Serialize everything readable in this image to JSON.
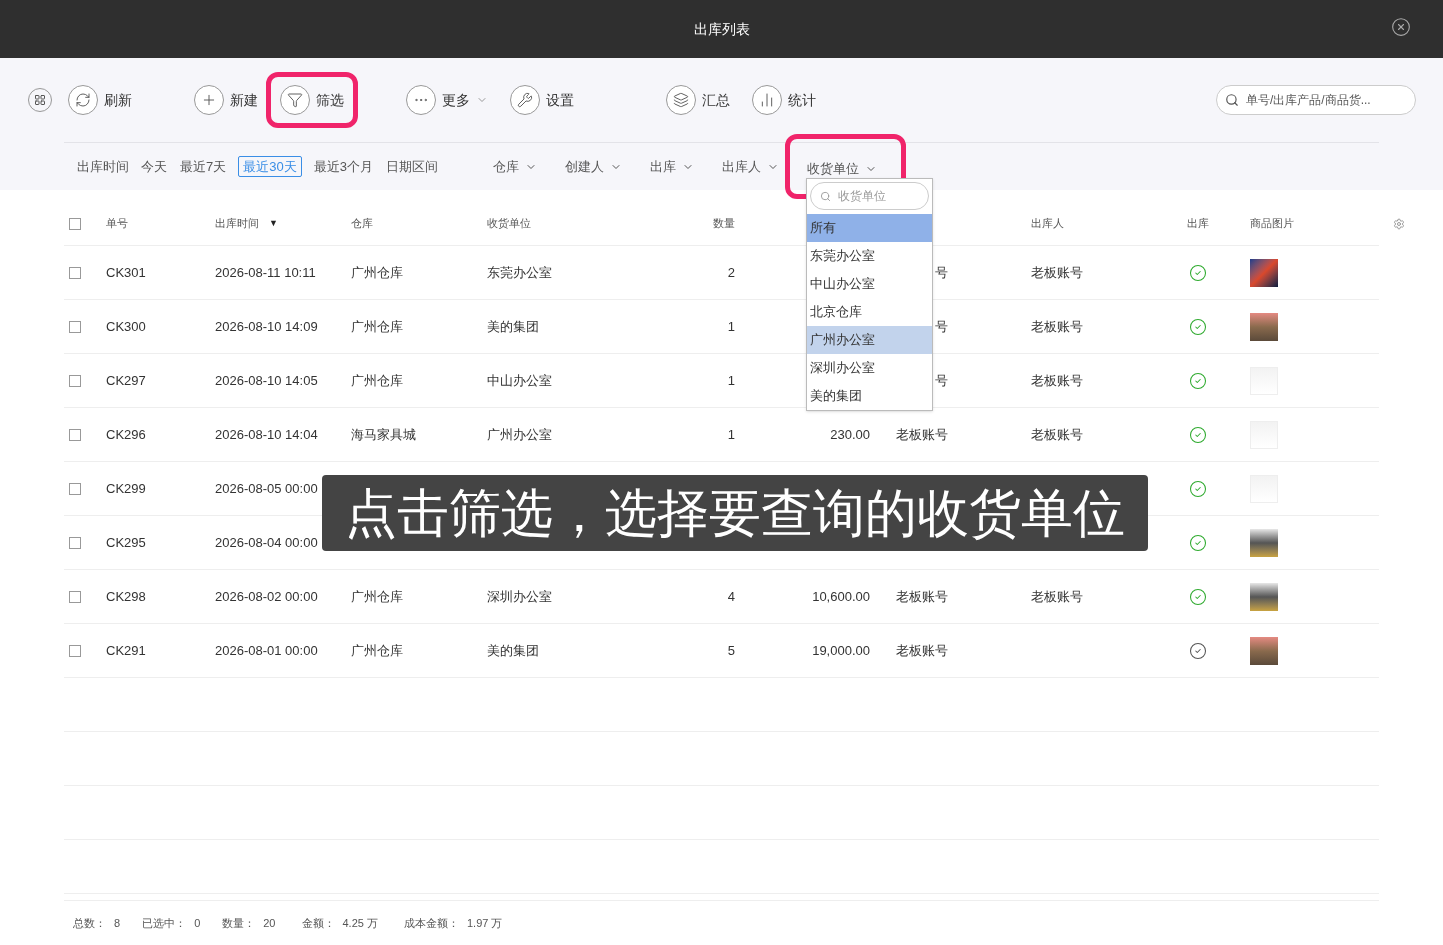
{
  "window": {
    "title": "出库列表"
  },
  "toolbar": {
    "groups": [
      [
        {
          "kind": "refresh",
          "label": "刷新",
          "highlighted": false,
          "has_menu": false
        }
      ],
      [
        {
          "kind": "plus",
          "label": "新建",
          "highlighted": false,
          "has_menu": false
        },
        {
          "kind": "funnel",
          "label": "筛选",
          "highlighted": true,
          "has_menu": false
        }
      ],
      [
        {
          "kind": "dots",
          "label": "更多",
          "highlighted": false,
          "has_menu": true
        },
        {
          "kind": "wrench",
          "label": "设置",
          "highlighted": false,
          "has_menu": false
        }
      ],
      [
        {
          "kind": "layers",
          "label": "汇总",
          "highlighted": false,
          "has_menu": false
        },
        {
          "kind": "bars",
          "label": "统计",
          "highlighted": false,
          "has_menu": false
        }
      ]
    ],
    "search": {
      "placeholder": "单号/出库产品/商品货..."
    }
  },
  "filters": {
    "date_label": "出库时间",
    "date_options": [
      {
        "label": "今天",
        "selected": false
      },
      {
        "label": "最近7天",
        "selected": false
      },
      {
        "label": "最近30天",
        "selected": true
      },
      {
        "label": "最近3个月",
        "selected": false
      },
      {
        "label": "日期区间",
        "selected": false
      }
    ],
    "dropdowns": [
      {
        "label": "仓库",
        "highlighted": false
      },
      {
        "label": "创建人",
        "highlighted": false
      },
      {
        "label": "出库",
        "highlighted": false
      },
      {
        "label": "出库人",
        "highlighted": false
      },
      {
        "label": "收货单位",
        "highlighted": true
      }
    ]
  },
  "dropdown_menu": {
    "search_placeholder": "收货单位",
    "options": [
      {
        "label": "所有",
        "selected": true,
        "hovered": false
      },
      {
        "label": "东莞办公室",
        "selected": false,
        "hovered": false
      },
      {
        "label": "中山办公室",
        "selected": false,
        "hovered": false
      },
      {
        "label": "北京仓库",
        "selected": false,
        "hovered": false
      },
      {
        "label": "广州办公室",
        "selected": false,
        "hovered": true
      },
      {
        "label": "深圳办公室",
        "selected": false,
        "hovered": false
      },
      {
        "label": "美的集团",
        "selected": false,
        "hovered": false
      }
    ]
  },
  "table": {
    "select_all_checked": false,
    "columns": [
      {
        "label": "单号"
      },
      {
        "label": "出库时间",
        "sort_mark": "▼"
      },
      {
        "label": "仓库"
      },
      {
        "label": "收货单位"
      },
      {
        "label": "数量"
      },
      {},
      {},
      {
        "label": "出库人"
      },
      {
        "label": "出库"
      },
      {
        "label": "商品图片"
      }
    ],
    "rows": [
      {
        "checked": false,
        "no": "CK301",
        "time": "2026-08-11 10:11",
        "warehouse": "广州仓库",
        "receiver": "东莞办公室",
        "qty": "2",
        "creator": "号",
        "creator_clipped": true,
        "operator": "老板账号",
        "done": true,
        "image": {
          "kind": "tv"
        }
      },
      {
        "checked": false,
        "no": "CK300",
        "time": "2026-08-10 14:09",
        "warehouse": "广州仓库",
        "receiver": "美的集团",
        "qty": "1",
        "creator": "号",
        "creator_clipped": true,
        "operator": "老板账号",
        "done": true,
        "image": {
          "kind": "stump"
        }
      },
      {
        "checked": false,
        "no": "CK297",
        "time": "2026-08-10 14:05",
        "warehouse": "广州仓库",
        "receiver": "中山办公室",
        "qty": "1",
        "creator": "号",
        "creator_clipped": true,
        "operator": "老板账号",
        "done": true,
        "image": {
          "kind": "fan"
        }
      },
      {
        "checked": false,
        "no": "CK296",
        "time": "2026-08-10 14:04",
        "warehouse": "海马家具城",
        "receiver": "广州办公室",
        "qty": "1",
        "amount": "230.00",
        "creator": "老板账号",
        "creator_clipped": false,
        "operator": "老板账号",
        "done": true,
        "image": {
          "kind": "fan"
        }
      },
      {
        "checked": false,
        "no": "CK299",
        "time": "2026-08-05 00:00",
        "done": true,
        "image": {
          "kind": "fan"
        }
      },
      {
        "checked": false,
        "no": "CK295",
        "time": "2026-08-04 00:00",
        "done": true,
        "image": {
          "kind": "printer"
        }
      },
      {
        "checked": false,
        "no": "CK298",
        "time": "2026-08-02 00:00",
        "warehouse": "广州仓库",
        "receiver": "深圳办公室",
        "qty": "4",
        "amount": "10,600.00",
        "creator": "老板账号",
        "creator_clipped": false,
        "operator": "老板账号",
        "done": true,
        "image": {
          "kind": "printer"
        }
      },
      {
        "checked": false,
        "no": "CK291",
        "time": "2026-08-01 00:00",
        "warehouse": "广州仓库",
        "receiver": "美的集团",
        "qty": "5",
        "amount": "19,000.00",
        "creator": "老板账号",
        "creator_clipped": false,
        "done": false,
        "image": {
          "kind": "stump"
        }
      }
    ]
  },
  "footer": [
    {
      "label": "总数：",
      "value": "8"
    },
    {
      "label": "已选中：",
      "value": "0"
    },
    {
      "label": "数量：",
      "value": "20"
    },
    {
      "label": "金额：",
      "value": "4.25 万"
    },
    {
      "label": "成本金额：",
      "value": "1.97 万"
    }
  ],
  "caption": "点击筛选，选择要查询的收货单位"
}
